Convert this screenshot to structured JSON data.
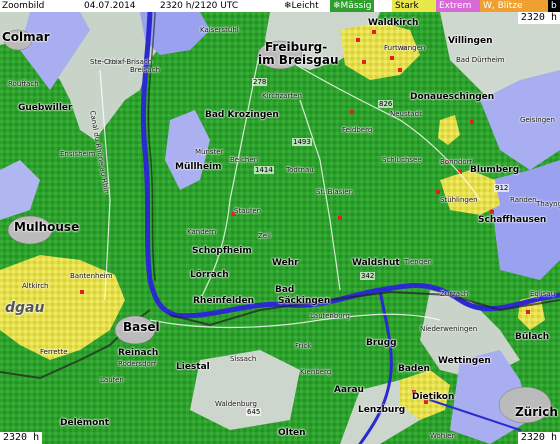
{
  "header": {
    "mode": "Zoombild",
    "date": "04.07.2014",
    "time": "2320 h/2120 UTC"
  },
  "legend": [
    {
      "label": "Leicht",
      "bg": "#ffffff",
      "fg": "#000000",
      "icon": "snowflake-icon",
      "glyph": "❄"
    },
    {
      "label": "Mässig",
      "bg": "#2e9e2e",
      "fg": "#ffffff",
      "icon": "snowflake-icon",
      "glyph": "❄"
    },
    {
      "label": "Stark",
      "bg": "#e8e84a",
      "fg": "#000000"
    },
    {
      "label": "Extrem",
      "bg": "#d86ad8",
      "fg": "#ffffff"
    },
    {
      "label": "W, Blitze",
      "bg": "#f0a030",
      "fg": "#ffffff"
    },
    {
      "label": "b",
      "bg": "#000000",
      "fg": "#ffffff"
    }
  ],
  "corner_labels": {
    "top_right": "2320 h",
    "bottom_left": "2320 h",
    "bottom_right": "2320 h"
  },
  "places": {
    "colmar": "Colmar",
    "freiburg1": "Freiburg-",
    "freiburg2": "im Breisgau",
    "villingen": "Villingen",
    "waldkirch": "Waldkirch",
    "donaueschingen": "Donaueschingen",
    "bad_krozingen": "Bad Krozingen",
    "guebwiller": "Guebwiller",
    "muellheim": "Müllheim",
    "mulhouse": "Mulhouse",
    "schopfheim": "Schopfheim",
    "loerrach": "Lörrach",
    "wehr": "Wehr",
    "rheinfelden": "Rheinfelden",
    "bad": "Bad",
    "saeckingen": "Säckingen",
    "waldshut": "Waldshut",
    "basel": "Basel",
    "schaffhausen": "Schaffhausen",
    "blumberg": "Blumberg",
    "bonndorf": "Bonndorf",
    "feldberg": "Feldberg",
    "neustadt": "Neustadt",
    "schluchsee": "Schluchsee",
    "st_blasien": "St. Blasien",
    "kirchzarten": "Kirchzarten",
    "furtwangen": "Furtwangen",
    "bad_duerrheim": "Bad Dürrheim",
    "breisach": "Breisach",
    "kaiserstuhl": "Kaiserstuhl",
    "neuf_brisach": "Neuf-Brisach",
    "ste_croix": "Ste-Croix",
    "rouffach": "Rouffach",
    "ensisheim": "Ensisheim",
    "kandern": "Kandern",
    "zell": "Zell",
    "todtnau": "Todtnau",
    "belchen": "Belchen",
    "staufen": "Staufen",
    "muenster": "Münster",
    "tiengen": "Tiengen",
    "stuehlingen": "Stühlingen",
    "gaisingen": "Geisingen",
    "randen": "Randen",
    "thayngen": "Thayngen",
    "laufenburg": "Laufenburg",
    "bruegg": "Brugg",
    "baden": "Baden",
    "wettingen": "Wettingen",
    "dietikon": "Dietikon",
    "zuerich": "Zürich",
    "buelach": "Bülach",
    "niederweningen": "Niederweningen",
    "eglisau": "Eglisau",
    "aarau": "Aarau",
    "lenzburg": "Lenzburg",
    "olten": "Olten",
    "liestal": "Liestal",
    "sissach": "Sissach",
    "frick": "Frick",
    "delemont": "Delémont",
    "laufen": "Laufen",
    "reinach": "Reinach",
    "rodersdorf": "Rodersdorf",
    "ferrette": "Ferrette",
    "altkirch": "Altkirch",
    "bantenheim": "Bantenheim",
    "waldenburg": "Waldenburg",
    "wohlen": "Wohlen",
    "kienberg": "Kienberg",
    "zurzach": "Zurzach",
    "sundgau": "dgau",
    "canal": "Canal du Rhône au Rhin",
    "road_278": "278",
    "road_826": "826",
    "road_1493": "1493",
    "road_1414": "1414",
    "road_342": "342",
    "road_912": "912",
    "road_645": "645"
  }
}
